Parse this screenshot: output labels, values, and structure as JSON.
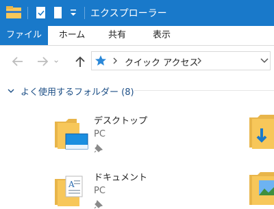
{
  "window": {
    "title": "エクスプローラー"
  },
  "ribbon": {
    "tabs": [
      {
        "label": "ファイル",
        "active": true
      },
      {
        "label": "ホーム"
      },
      {
        "label": "共有"
      },
      {
        "label": "表示"
      }
    ]
  },
  "address": {
    "path_label": "クイック アクセス"
  },
  "quick_access": {
    "group_label": "よく使用するフォルダー (8)",
    "items": [
      {
        "name": "デスクトップ",
        "location": "PC",
        "pinned": true
      },
      {
        "name": "ドキュメント",
        "location": "PC",
        "pinned": true
      }
    ]
  },
  "colors": {
    "titlebar": "#1979ca",
    "accent": "#1979ca",
    "folder": "#f7c75a",
    "group_label": "#1d4f86"
  },
  "icons": [
    "explorer-icon",
    "properties-icon",
    "new-folder-icon",
    "quick-access-chevron-icon",
    "back-icon",
    "forward-icon",
    "recent-dropdown-icon",
    "up-icon",
    "star-icon",
    "desktop-folder-icon",
    "documents-folder-icon",
    "downloads-folder-icon",
    "pictures-folder-icon",
    "pin-icon"
  ]
}
